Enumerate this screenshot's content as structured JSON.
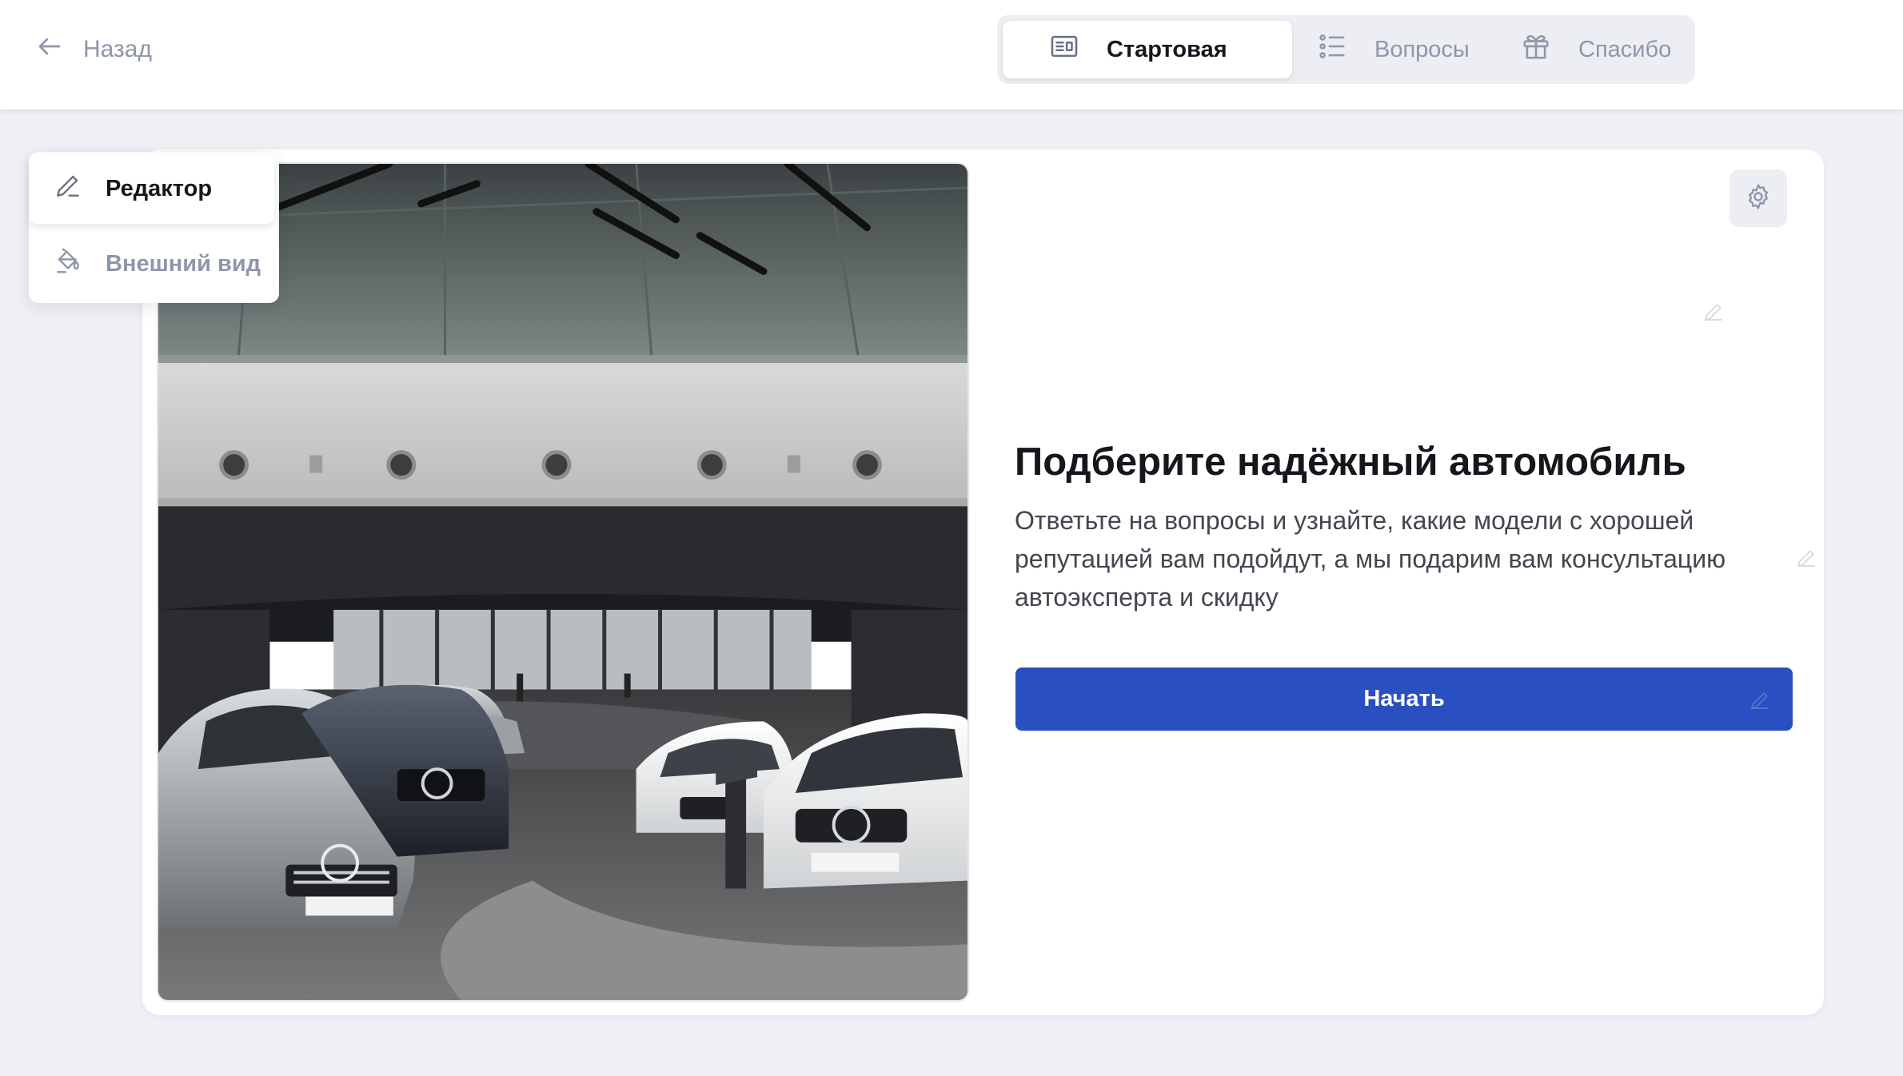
{
  "header": {
    "back_label": "Назад",
    "steps": [
      {
        "label": "Стартовая",
        "icon": "layout-icon",
        "active": true
      },
      {
        "label": "Вопросы",
        "icon": "list-icon",
        "active": false
      },
      {
        "label": "Спасибо",
        "icon": "gift-icon",
        "active": false
      }
    ]
  },
  "side_menu": {
    "items": [
      {
        "label": "Редактор",
        "icon": "pencil-icon",
        "active": true
      },
      {
        "label": "Внешний вид",
        "icon": "paint-bucket-icon",
        "active": false
      }
    ]
  },
  "card": {
    "image_alt": "car-showroom-photo",
    "title": "Подберите надёжный автомобиль",
    "subtitle": "Ответьте на вопросы и узнайте, какие модели с хорошей репутацией вам подойдут, а мы подарим вам консультацию автоэксперта и скидку",
    "start_button": "Начать",
    "settings_icon": "gear-icon"
  },
  "colors": {
    "accent": "#2a4fc0",
    "background": "#eff0f5",
    "muted_text": "#8f96aa"
  }
}
